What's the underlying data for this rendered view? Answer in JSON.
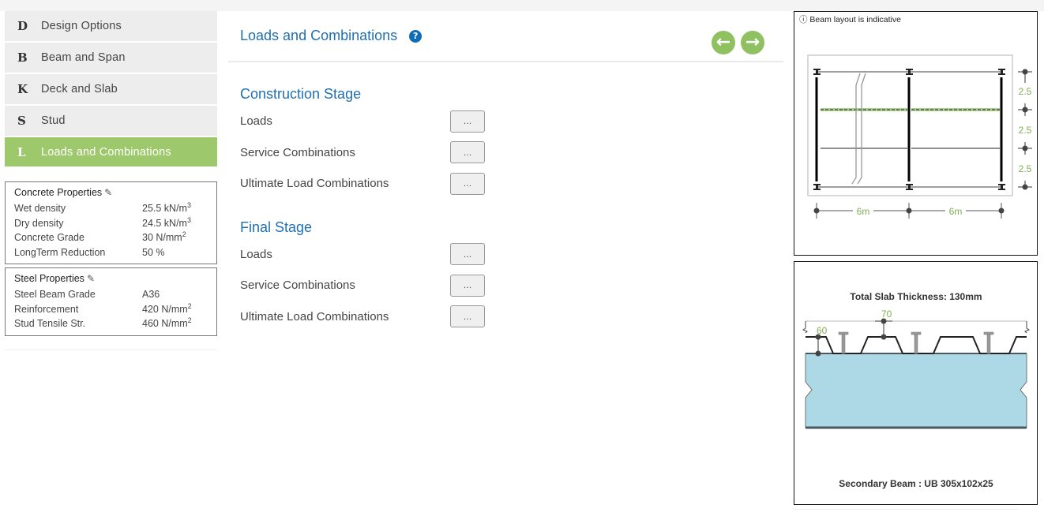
{
  "sidebar": {
    "nav": [
      {
        "letter": "D",
        "label": "Design Options",
        "active": false
      },
      {
        "letter": "B",
        "label": "Beam and Span",
        "active": false
      },
      {
        "letter": "K",
        "label": "Deck and Slab",
        "active": false
      },
      {
        "letter": "S",
        "label": "Stud",
        "active": false
      },
      {
        "letter": "L",
        "label": "Loads and Combinations",
        "active": true
      }
    ],
    "concrete": {
      "title": "Concrete Properties",
      "edit_icon": "✎",
      "rows": [
        {
          "key": "Wet density",
          "value": "25.5 kN/m",
          "sup": "3"
        },
        {
          "key": "Dry density",
          "value": "24.5 kN/m",
          "sup": "3"
        },
        {
          "key": "Concrete Grade",
          "value": "30 N/mm",
          "sup": "2"
        },
        {
          "key": "LongTerm Reduction",
          "value": "50 %",
          "sup": ""
        }
      ]
    },
    "steel": {
      "title": "Steel Properties",
      "edit_icon": "✎",
      "rows": [
        {
          "key": "Steel Beam Grade",
          "value": "A36",
          "sup": ""
        },
        {
          "key": "Reinforcement",
          "value": "420 N/mm",
          "sup": "2"
        },
        {
          "key": "Stud Tensile Str.",
          "value": "460 N/mm",
          "sup": "2"
        }
      ]
    }
  },
  "main": {
    "title": "Loads and Combinations",
    "help_icon": "?",
    "prev_icon": "←",
    "next_icon": "→",
    "sections": [
      {
        "title": "Construction Stage",
        "rows": [
          {
            "label": "Loads",
            "button": "..."
          },
          {
            "label": "Service Combinations",
            "button": "..."
          },
          {
            "label": "Ultimate Load Combinations",
            "button": "..."
          }
        ]
      },
      {
        "title": "Final Stage",
        "rows": [
          {
            "label": "Loads",
            "button": "..."
          },
          {
            "label": "Service Combinations",
            "button": "..."
          },
          {
            "label": "Ultimate Load Combinations",
            "button": "..."
          }
        ]
      }
    ]
  },
  "layout_panel": {
    "note": "ⓘ Beam layout is indicative",
    "spacing_labels": [
      "2.5",
      "2.5",
      "2.5"
    ],
    "span_labels": [
      "6m",
      "6m"
    ]
  },
  "section_panel": {
    "total_thickness": "Total Slab Thickness: 130mm",
    "deck_depth_label": "60",
    "topping_label": "70",
    "beam_label": "Secondary Beam : UB 305x102x25"
  },
  "colors": {
    "accent_green": "#9dc86b",
    "arrow_green": "#8fc160",
    "title_blue": "#1f6fb2",
    "dimension_green": "#7fae55",
    "concrete_fill": "#add8e6"
  }
}
